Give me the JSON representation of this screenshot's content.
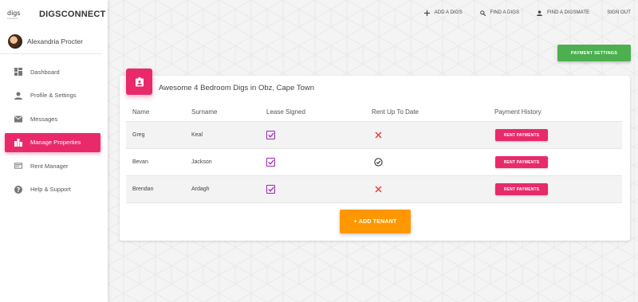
{
  "brand": {
    "logo_top": "digs",
    "logo_bottom": "connect",
    "name": "DIGSCONNECT"
  },
  "user": {
    "name": "Alexandria Procter"
  },
  "sidebar": {
    "items": [
      {
        "label": "Dashboard",
        "icon": "dashboard-icon",
        "active": false
      },
      {
        "label": "Profile & Settings",
        "icon": "person-icon",
        "active": false
      },
      {
        "label": "Messages",
        "icon": "mail-icon",
        "active": false
      },
      {
        "label": "Manage Properties",
        "icon": "building-icon",
        "active": true
      },
      {
        "label": "Rent Manager",
        "icon": "card-icon",
        "active": false
      },
      {
        "label": "Help & Support",
        "icon": "help-icon",
        "active": false
      }
    ]
  },
  "topbar": {
    "add_digs": "ADD A DIGS",
    "find_digs": "FIND A DIGS",
    "find_digsmate": "FIND A DIGSMATE",
    "sign_out": "SIGN OUT"
  },
  "payment_settings_label": "PAYMENT SETTINGS",
  "property": {
    "title": "Awesome 4 Bedroom Digs in Obz, Cape Town",
    "columns": [
      "Name",
      "Surname",
      "Lease Signed",
      "Rent Up To Date",
      "Payment History"
    ],
    "tenants": [
      {
        "name": "Greg",
        "surname": "Keal",
        "lease_signed": true,
        "rent_up_to_date": false,
        "action": "RENT PAYMENTS"
      },
      {
        "name": "Bevan",
        "surname": "Jackson",
        "lease_signed": true,
        "rent_up_to_date": true,
        "action": "RENT PAYMENTS"
      },
      {
        "name": "Brendan",
        "surname": "Ardagh",
        "lease_signed": true,
        "rent_up_to_date": false,
        "action": "RENT PAYMENTS"
      }
    ],
    "add_tenant_label": "+ ADD TENANT"
  },
  "colors": {
    "primary": "#e82a6a",
    "success": "#4caf50",
    "warning": "#ff9800",
    "checkbox": "#9c27b0",
    "error": "#e53935"
  }
}
